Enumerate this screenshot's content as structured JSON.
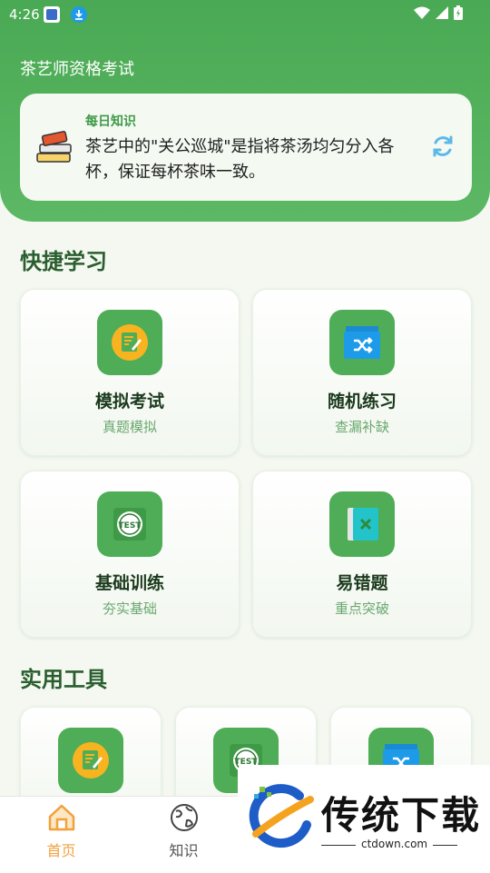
{
  "status_bar": {
    "time": "4:26"
  },
  "header": {
    "title": "茶艺师资格考试"
  },
  "daily": {
    "title": "每日知识",
    "text": "茶艺中的\"关公巡城\"是指将茶汤均匀分入各杯，保证每杯茶味一致。"
  },
  "quick": {
    "section_title": "快捷学习",
    "cards": [
      {
        "title": "模拟考试",
        "subtitle": "真题模拟",
        "icon": "exam-pencil-icon"
      },
      {
        "title": "随机练习",
        "subtitle": "查漏补缺",
        "icon": "shuffle-icon"
      },
      {
        "title": "基础训练",
        "subtitle": "夯实基础",
        "icon": "test-badge-icon"
      },
      {
        "title": "易错题",
        "subtitle": "重点突破",
        "icon": "error-book-icon"
      }
    ]
  },
  "tools": {
    "section_title": "实用工具",
    "icons": [
      "exam-pencil-icon",
      "test-badge-icon",
      "shuffle-icon"
    ]
  },
  "tabbar": {
    "tabs": [
      {
        "label": "首页",
        "icon": "home-icon",
        "active": true
      },
      {
        "label": "知识",
        "icon": "globe-icon",
        "active": false
      }
    ]
  },
  "watermark": {
    "brand": "传统下载",
    "url": "ctdown.com"
  },
  "colors": {
    "primary": "#4fad57",
    "accent": "#f1a13e",
    "header_text": "#ffffff"
  }
}
